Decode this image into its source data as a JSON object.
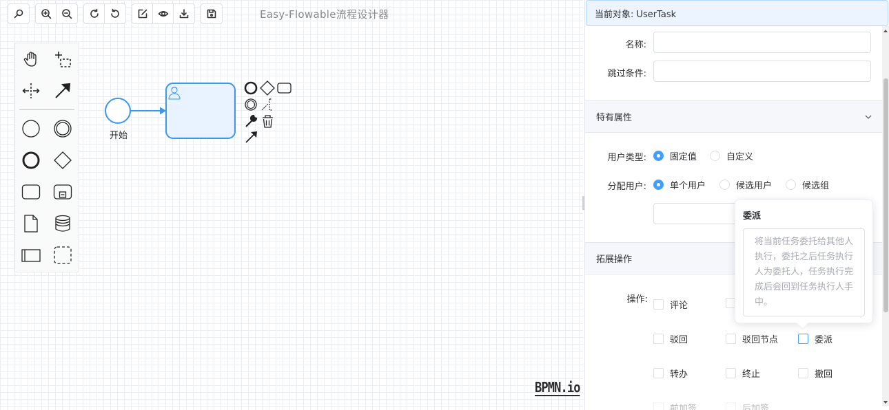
{
  "app": {
    "title": "Easy-Flowable流程设计器"
  },
  "toolbar": {
    "groups": [
      [
        {
          "icon": "search-icon"
        }
      ],
      [
        {
          "icon": "zoom-in-icon"
        },
        {
          "icon": "zoom-out-icon"
        }
      ],
      [
        {
          "icon": "redo-icon"
        },
        {
          "icon": "undo-icon"
        }
      ],
      [
        {
          "icon": "import-icon"
        },
        {
          "icon": "preview-eye-icon"
        },
        {
          "icon": "download-icon"
        }
      ],
      [
        {
          "icon": "save-icon"
        }
      ]
    ]
  },
  "palette": {
    "tools": [
      "hand-tool-icon",
      "lasso-tool-icon",
      "space-tool-icon",
      "connect-tool-icon"
    ],
    "elements": [
      "start-event-icon",
      "intermediate-event-icon",
      "end-event-icon",
      "gateway-icon",
      "task-icon",
      "subprocess-icon",
      "data-object-icon",
      "data-store-icon",
      "pool-icon",
      "group-icon"
    ]
  },
  "diagram": {
    "start_label": "开始",
    "accent": "#3b96ef",
    "task_fill": "#e9f3ff"
  },
  "panel": {
    "current_object": "当前对象: UserTask",
    "name_label": "名称:",
    "name_value": "",
    "skip_label": "跳过条件:",
    "skip_value": "",
    "special_section": "特有属性",
    "user_type_label": "用户类型:",
    "user_type_options": [
      "固定值",
      "自定义"
    ],
    "user_type_selected": "固定值",
    "assign_label": "分配用户:",
    "assign_options": [
      "单个用户",
      "候选用户",
      "候选组"
    ],
    "assign_selected": "单个用户",
    "assign_value": "",
    "ext_section": "拓展操作",
    "ops_label": "操作:",
    "ops": [
      {
        "label": "评论",
        "checked": false
      },
      {
        "label": "驳回",
        "checked": false
      },
      {
        "label": "驳回节点",
        "checked": false
      },
      {
        "label": "委派",
        "checked": false
      },
      {
        "label": "转办",
        "checked": false
      },
      {
        "label": "终止",
        "checked": false
      },
      {
        "label": "撤回",
        "checked": false
      },
      {
        "label": "前加签",
        "checked": false
      },
      {
        "label": "后加签",
        "checked": false
      }
    ]
  },
  "popover": {
    "title": "委派",
    "text": "将当前任务委托给其他人执行，委托之后任务执行人为委托人，任务执行完成后会回到任务执行人手中。"
  },
  "brand": {
    "logo": "BPMN.io"
  },
  "colors": {
    "primary": "#409eff",
    "panel_header_bg": "#ecf5ff",
    "section_bg": "#f5f7fa"
  }
}
